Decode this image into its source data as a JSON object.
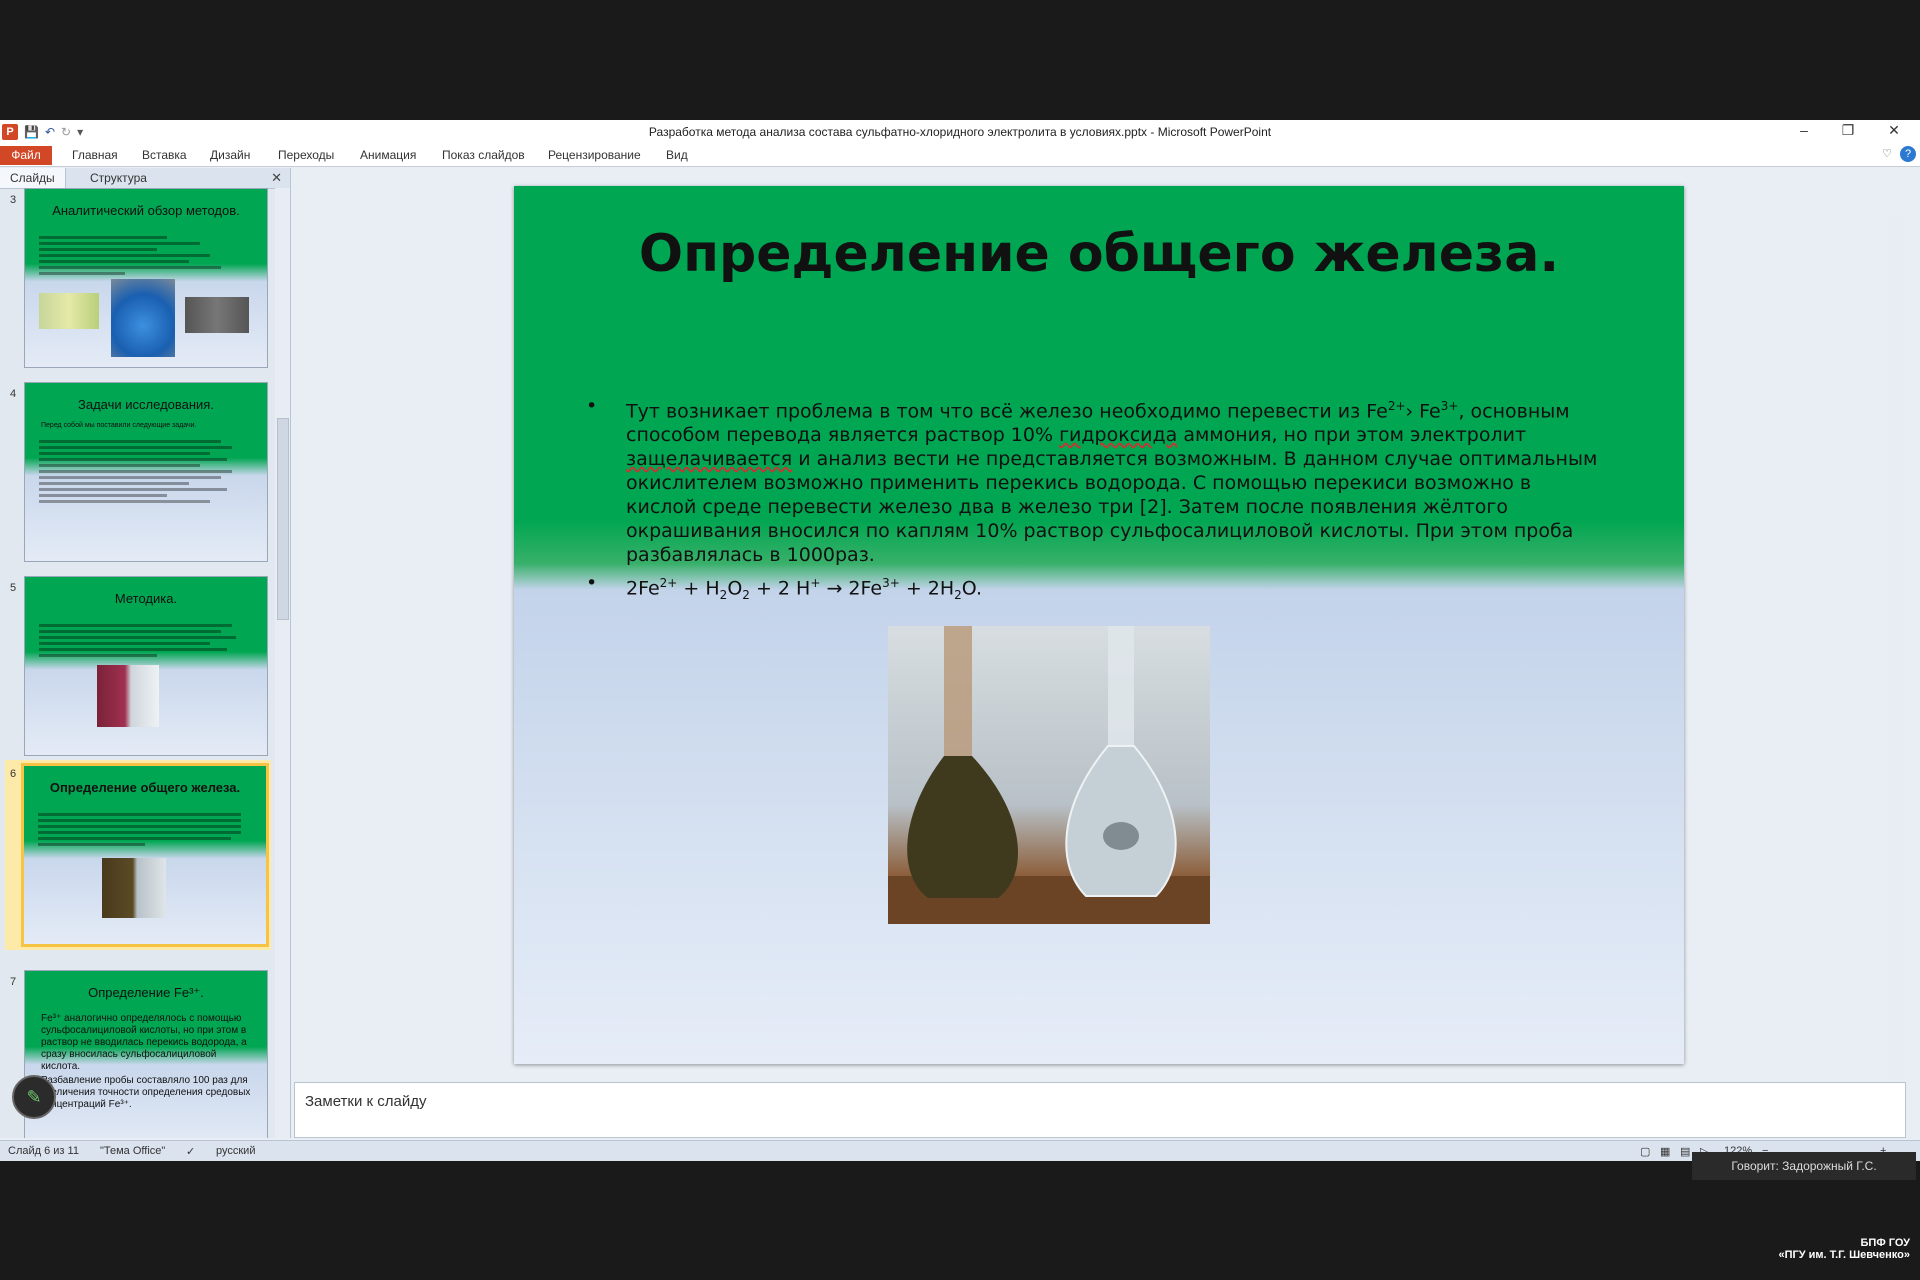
{
  "window": {
    "title": "Разработка метода анализа состава сульфатно-хлоридного электролита в условиях.pptx - Microsoft PowerPoint",
    "app_letter": "P"
  },
  "ribbon": {
    "file_tab": "Файл",
    "tabs": [
      "Главная",
      "Вставка",
      "Дизайн",
      "Переходы",
      "Анимация",
      "Показ слайдов",
      "Рецензирование",
      "Вид"
    ]
  },
  "panel": {
    "tabs": [
      "Слайды",
      "Структура"
    ],
    "thumbs": [
      {
        "num": "3",
        "title": "Аналитический обзор методов."
      },
      {
        "num": "4",
        "title": "Задачи исследования.",
        "intro": "Перед собой мы поставили следующие задачи."
      },
      {
        "num": "5",
        "title": "Методика."
      },
      {
        "num": "6",
        "title": "Определение общего железа."
      },
      {
        "num": "7",
        "title": "Определение Fe³⁺.",
        "lines": [
          "Fe³⁺ аналогично определялось с помощью сульфосалициловой кислоты, но при этом в раствор не вводилась перекись водорода, а сразу вносилась сульфосалициловой кислота.",
          "Разбавление пробы составляло 100 раз для увеличения точности определения средовых концентраций Fe³⁺."
        ]
      }
    ]
  },
  "slide": {
    "title": "Определение общего железа.",
    "bullet1_parts": {
      "a": "Тут возникает проблема в том что всё железо необходимо перевести из  Fe",
      "sup1": "2+",
      "b": "› Fe",
      "sup2": "3+",
      "c": ", основным способом перевода является раствор 10% ",
      "ul1": "гидроксида",
      "d": " аммония, но при этом электролит ",
      "ul2": "защелачивается",
      "e": " и анализ вести не представляется возможным. В данном случае оптимальным окислителем возможно применить перекись водорода. С помощью перекиси возможно в кислой среде перевести железо два в железо три [2].  Затем после появления жёлтого окрашивания вносился по каплям 10% раствор сульфосалициловой кислоты. При этом проба разбавлялась в 1000раз."
    },
    "bullet2_parts": {
      "a": "2Fe",
      "sup1": "2+",
      "b": " + H",
      "sub1": "2",
      "c": "O",
      "sub2": "2",
      "d": " + 2 H",
      "sup2": "+",
      "e": " → 2Fe",
      "sup3": "3+",
      "f": " + 2H",
      "sub3": "2",
      "g": "O."
    },
    "bullet_symbol": "•"
  },
  "notes": {
    "placeholder": "Заметки к слайду"
  },
  "status": {
    "slide_info": "Слайд 6 из 11",
    "theme": "\"Тема Office\"",
    "language": "русский",
    "zoom": "122%"
  },
  "overlay": {
    "speaker": "Говорит: Задорожный Г.С.",
    "watermark_line1": "БПФ ГОУ",
    "watermark_line2": "«ПГУ им. Т.Г. Шевченко»"
  },
  "colors": {
    "slide_green": "#00a651",
    "file_tab": "#d24726",
    "selection": "#f6c342"
  }
}
